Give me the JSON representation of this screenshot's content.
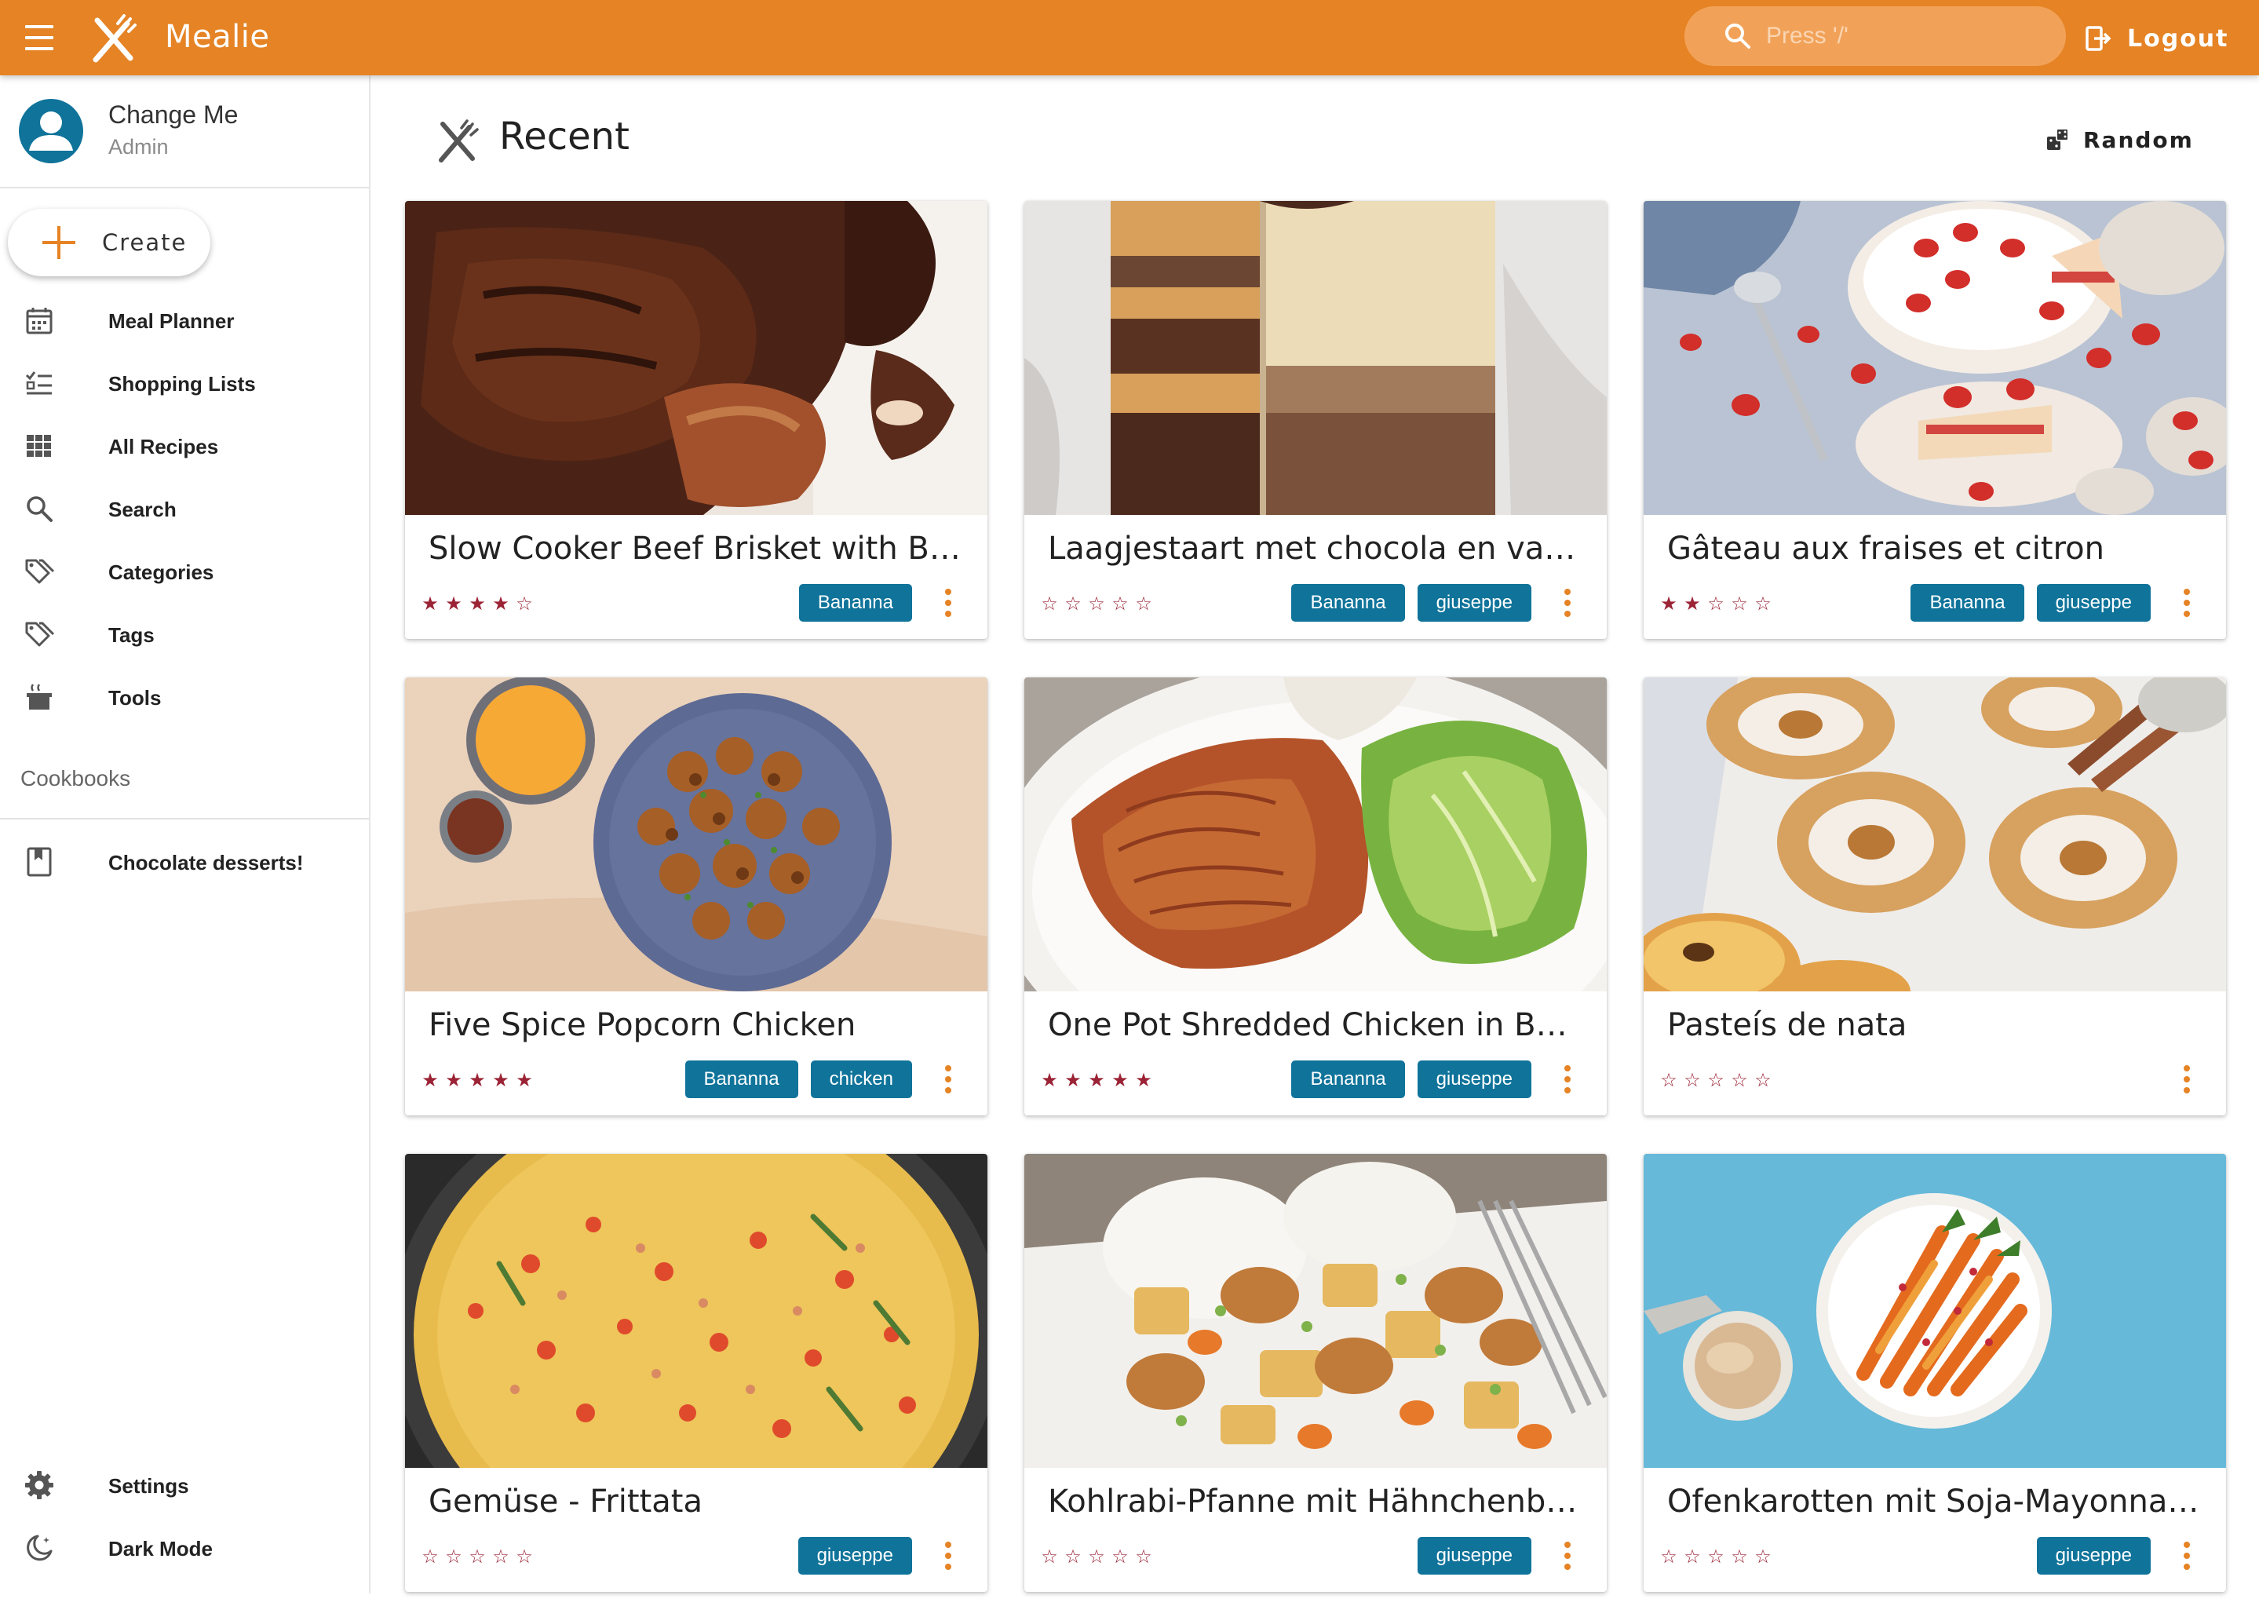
{
  "appbar": {
    "title": "Mealie",
    "search_placeholder": "Press '/'",
    "logout_label": "Logout",
    "accent": "#E58325"
  },
  "user": {
    "name": "Change Me",
    "role": "Admin"
  },
  "sidebar": {
    "create_label": "Create",
    "items": [
      {
        "label": "Meal Planner",
        "icon": "calendar-icon"
      },
      {
        "label": "Shopping Lists",
        "icon": "list-check-icon"
      },
      {
        "label": "All Recipes",
        "icon": "grid-icon"
      },
      {
        "label": "Search",
        "icon": "search-icon"
      },
      {
        "label": "Categories",
        "icon": "tags-icon"
      },
      {
        "label": "Tags",
        "icon": "tags-icon"
      },
      {
        "label": "Tools",
        "icon": "pot-icon"
      }
    ],
    "cookbooks_heading": "Cookbooks",
    "cookbooks": [
      {
        "label": "Chocolate desserts!",
        "icon": "book-icon"
      }
    ],
    "bottom": [
      {
        "label": "Settings",
        "icon": "gear-icon"
      },
      {
        "label": "Dark Mode",
        "icon": "moon-icon"
      }
    ]
  },
  "main": {
    "title": "Recent",
    "random_label": "Random",
    "tag_color": "#0F739A",
    "star_color": "#9B2335",
    "cards": [
      {
        "title": "Slow Cooker Beef Brisket with BBQ...",
        "rating": 4,
        "tags": [
          "Bananna"
        ]
      },
      {
        "title": "Laagjestaart met chocola en vanille",
        "rating": 0,
        "tags": [
          "Bananna",
          "giuseppe"
        ]
      },
      {
        "title": "Gâteau aux fraises et citron",
        "rating": 2,
        "tags": [
          "Bananna",
          "giuseppe"
        ]
      },
      {
        "title": "Five Spice Popcorn Chicken",
        "rating": 5,
        "tags": [
          "Bananna",
          "chicken"
        ]
      },
      {
        "title": "One Pot Shredded Chicken in Buffa...",
        "rating": 5,
        "tags": [
          "Bananna",
          "giuseppe"
        ]
      },
      {
        "title": "Pasteís de nata",
        "rating": 0,
        "tags": []
      },
      {
        "title": "Gemüse - Frittata",
        "rating": 0,
        "tags": [
          "giuseppe"
        ]
      },
      {
        "title": "Kohlrabi-Pfanne mit Hähnchenbrust",
        "rating": 0,
        "tags": [
          "giuseppe"
        ]
      },
      {
        "title": "Ofenkarotten mit Soja-Mayonnaise",
        "rating": 0,
        "tags": [
          "giuseppe"
        ]
      }
    ]
  }
}
